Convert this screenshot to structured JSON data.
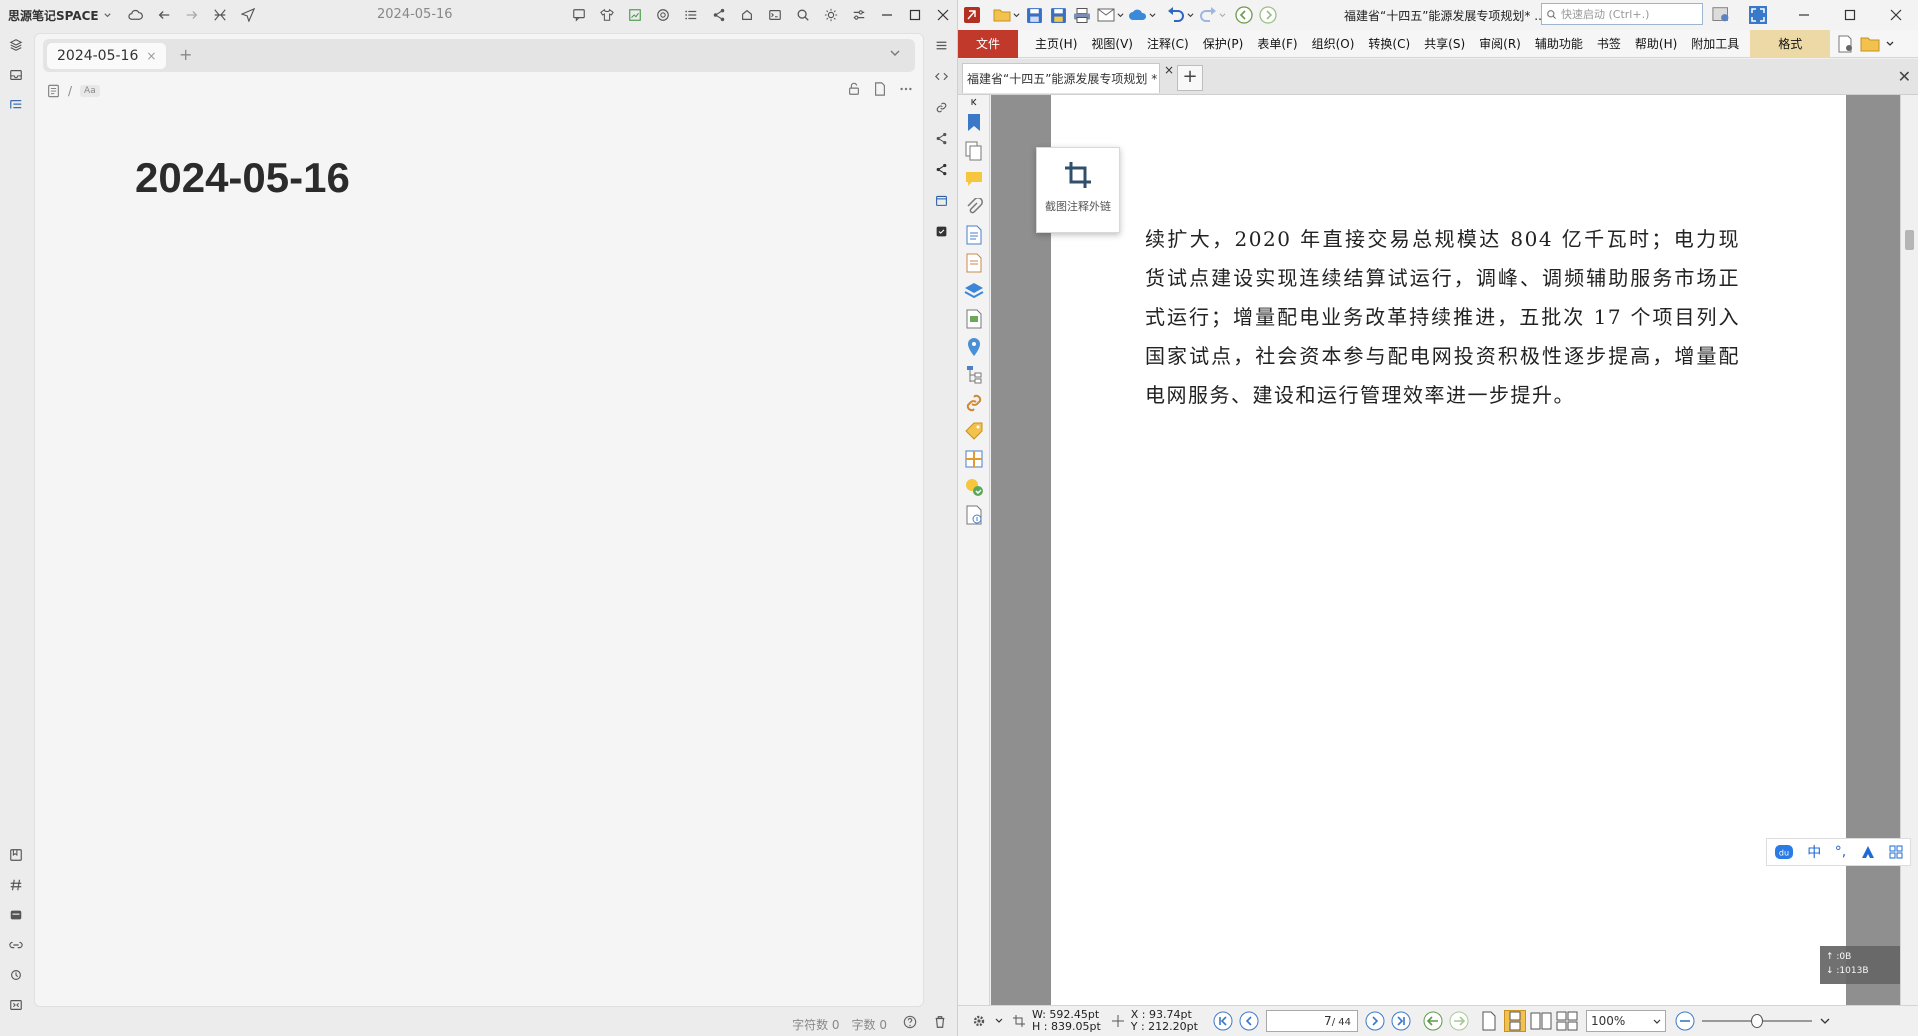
{
  "left_app": {
    "brand": "思源笔记SPACE",
    "title_date": "2024-05-16",
    "tab": {
      "label": "2024-05-16",
      "close": "×"
    },
    "add_tab": "+",
    "breadcrumb_sep": "/",
    "breadcrumb_aa": "Aa",
    "heading": "2024-05-16",
    "status": {
      "chars": "字符数 0",
      "words": "字数 0"
    }
  },
  "right_app": {
    "doc_title": "福建省“十四五”能源发展专项规划* ..",
    "search_placeholder": "快速启动 (Ctrl+.)",
    "menu": {
      "file": "文件",
      "items": [
        "主页(H)",
        "视图(V)",
        "注释(C)",
        "保护(P)",
        "表单(F)",
        "组织(O)",
        "转换(C)",
        "共享(S)",
        "审阅(R)",
        "辅助功能",
        "书签",
        "帮助(H)",
        "附加工具"
      ],
      "format": "格式"
    },
    "doc_tab": {
      "label": "福建省“十四五”能源发展专项规划 *",
      "close": "×"
    },
    "new_tab": "+",
    "close_all": "✕",
    "tool_popup": {
      "label": "截图注释外链"
    },
    "page_text": "续扩大，2020 年直接交易总规模达 804 亿千瓦时；电力现货试点建设实现连续结算试运行，调峰、调频辅助服务市场正式运行；增量配电业务改革持续推进，五批次 17 个项目列入国家试点，社会资本参与配电网投资积极性逐步提高，增量配电网服务、建设和运行管理效率进一步提升。",
    "ime": {
      "chinese": "中",
      "punct": "°,"
    },
    "mem": {
      "line1": "↑ :0B",
      "line2": "↓ :1013B"
    },
    "status": {
      "width": "W: 592.45pt",
      "height": "H : 839.05pt",
      "x": "X :   93.74pt",
      "y": "Y : 212.20pt",
      "page": "7",
      "total": "/ 44",
      "zoom": "100%"
    }
  }
}
